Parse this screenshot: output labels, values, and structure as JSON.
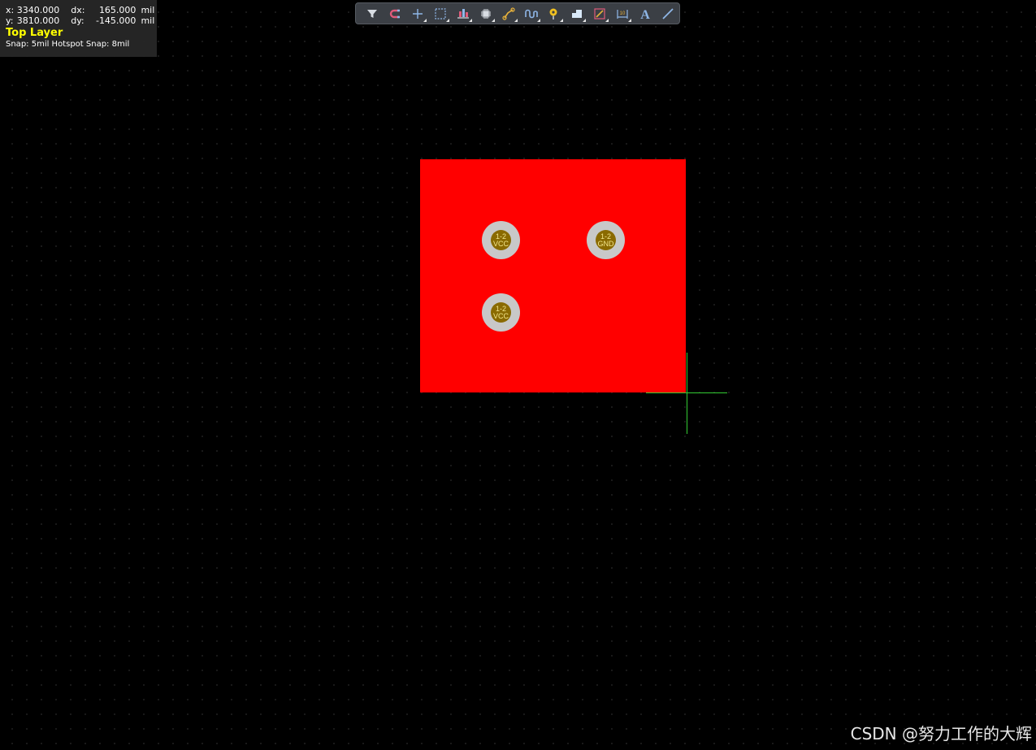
{
  "hud": {
    "x_label": "x:",
    "x_value": "3340.000",
    "dx_label": "dx:",
    "dx_value": "165.000",
    "dx_unit": "mil",
    "y_label": "y:",
    "y_value": "3810.000",
    "dy_label": "dy:",
    "dy_value": "-145.000",
    "dy_unit": "mil",
    "layer": "Top Layer",
    "snap": "Snap: 5mil Hotspot Snap: 8mil"
  },
  "toolbar": {
    "tools": [
      {
        "icon": "filter-icon",
        "has_menu": false
      },
      {
        "icon": "snap-magnet-icon",
        "has_menu": false
      },
      {
        "icon": "crosshair-move-icon",
        "has_menu": true
      },
      {
        "icon": "select-rectangle-icon",
        "has_menu": true
      },
      {
        "icon": "align-icon",
        "has_menu": true
      },
      {
        "icon": "component-icon",
        "has_menu": true
      },
      {
        "icon": "route-track-icon",
        "has_menu": true
      },
      {
        "icon": "interactive-length-tuning-icon",
        "has_menu": true
      },
      {
        "icon": "via-pad-icon",
        "has_menu": true
      },
      {
        "icon": "polygon-pour-icon",
        "has_menu": true
      },
      {
        "icon": "keepout-icon",
        "has_menu": true
      },
      {
        "icon": "dimension-icon",
        "has_menu": true
      },
      {
        "icon": "text-string-icon",
        "has_menu": false
      },
      {
        "icon": "line-icon",
        "has_menu": false
      }
    ]
  },
  "board": {
    "fill_color": "#ff0000",
    "vias": [
      {
        "designator": "1-2",
        "net": "VCC"
      },
      {
        "designator": "1-2",
        "net": "GND"
      },
      {
        "designator": "1-2",
        "net": "VCC"
      }
    ]
  },
  "colors": {
    "background": "#000000",
    "board": "#ff0000",
    "via_ring": "#c8c8c8",
    "via_hole": "#8a6a00",
    "layer_text": "#ffff00",
    "crosshair": "#33cc33"
  },
  "watermark": "CSDN @努力工作的大辉"
}
